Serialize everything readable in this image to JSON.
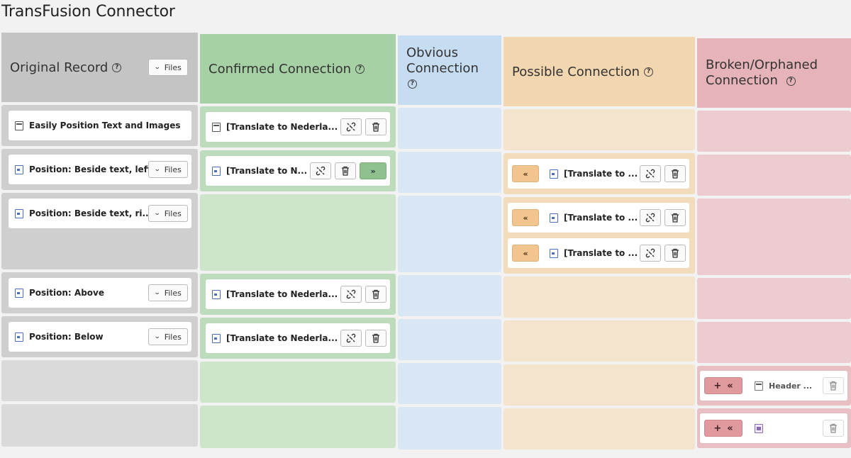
{
  "page": {
    "title": "TransFusion Connector"
  },
  "headers": {
    "original": "Original Record",
    "confirmed": "Confirmed Connection",
    "obvious_line1": "Obvious",
    "obvious_line2": "Connection",
    "possible": "Possible Connection",
    "broken_line1": "Broken/Orphaned",
    "broken_line2": "Connection",
    "files_label": "Files"
  },
  "colors": {
    "original": "#c4c4c4",
    "confirmed": "#a6d1a4",
    "obvious": "#c6dcf1",
    "possible": "#f2d6b0",
    "broken": "#e5b3b8"
  },
  "original_records": [
    {
      "label": "Easily Position Text and Images",
      "icon": "page-icon",
      "has_files": false
    },
    {
      "label": "Position: Beside text, left",
      "icon": "image-page-icon",
      "has_files": true
    },
    {
      "label": "Position: Beside text, ri...",
      "icon": "image-page-icon",
      "has_files": true
    },
    {
      "label": "Position: Above",
      "icon": "image-page-icon",
      "has_files": true
    },
    {
      "label": "Position: Below",
      "icon": "image-page-icon",
      "has_files": true
    }
  ],
  "confirmed_records": [
    {
      "label": "[Translate to Nederla..."
    },
    {
      "label": "[Translate to N..."
    },
    {
      "label": "[Translate to Nederla..."
    },
    {
      "label": "[Translate to Nederla..."
    }
  ],
  "possible_records": [
    {
      "label": "[Translate to ..."
    },
    {
      "label": "[Translate to ..."
    },
    {
      "label": "[Translate to ..."
    }
  ],
  "broken_records": [
    {
      "label": "Header ..."
    },
    {
      "label": ""
    }
  ],
  "glyphs": {
    "left": "«",
    "right": "»",
    "plus": "+"
  }
}
